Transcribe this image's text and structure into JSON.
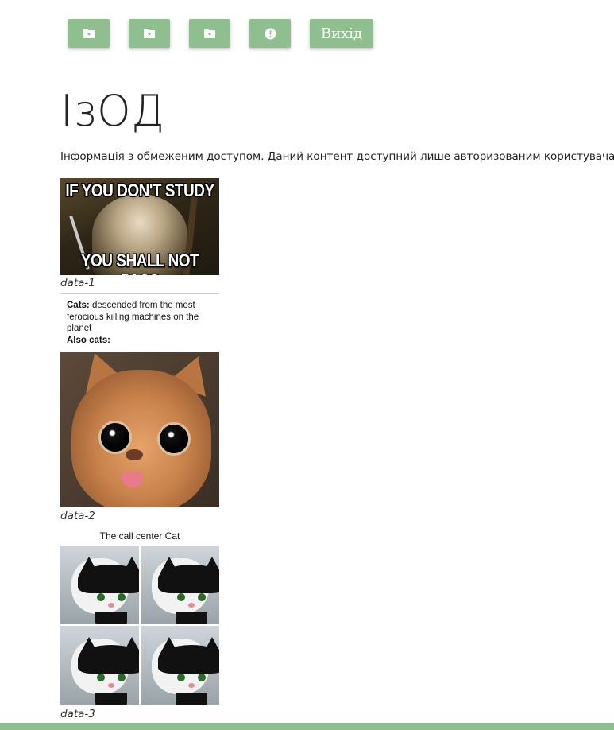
{
  "toolbar": {
    "buttons": [
      {
        "icon": "folder-star-icon"
      },
      {
        "icon": "folder-star-icon"
      },
      {
        "icon": "folder-star-icon"
      },
      {
        "icon": "alert-circle-icon"
      }
    ],
    "logout_label": "Вихід",
    "button_color": "#8fbf8e"
  },
  "page": {
    "title": "ІзОД",
    "info": "Інформація з обмеженим доступом. Даний контент доступний лише авторизованим користувачам."
  },
  "items": [
    {
      "caption": "data-1",
      "meme_top": "IF YOU DON'T STUDY",
      "meme_bottom": "YOU SHALL NOT PASS"
    },
    {
      "caption": "data-2",
      "text_bold_1": "Cats:",
      "text_1": " descended from the most ferocious killing machines on the planet",
      "text_bold_2": "Also cats:"
    },
    {
      "caption": "data-3",
      "title": "The call center Cat"
    }
  ],
  "colors": {
    "accent": "#8fbf8e"
  }
}
